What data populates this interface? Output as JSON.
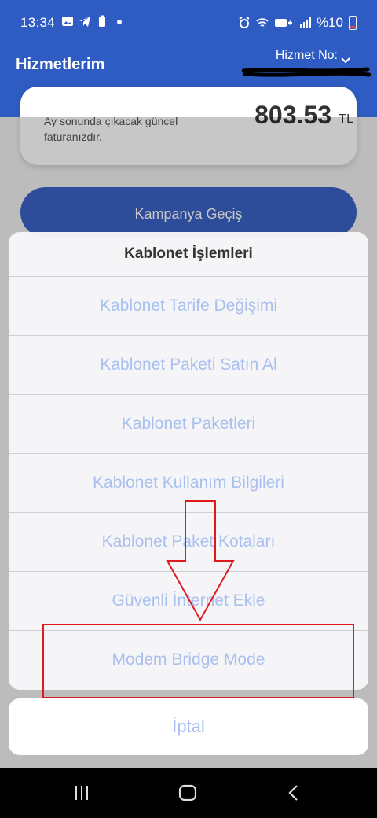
{
  "status_bar": {
    "time": "13:34",
    "battery_text": "%10"
  },
  "header": {
    "title": "Hizmetlerim",
    "service_label": "Hizmet No:"
  },
  "card": {
    "text": "Ay sonunda çıkacak güncel faturanızdır.",
    "amount": "803.53",
    "unit": "TL"
  },
  "campaign_button": {
    "label": "Kampanya Geçiş"
  },
  "sheet": {
    "title": "Kablonet İşlemleri",
    "options": [
      {
        "label": "Kablonet Tarife Değişimi"
      },
      {
        "label": "Kablonet Paketi Satın Al"
      },
      {
        "label": "Kablonet Paketleri"
      },
      {
        "label": "Kablonet Kullanım Bilgileri"
      },
      {
        "label": "Kablonet Paket Kotaları"
      },
      {
        "label": "Güvenli İnternet Ekle"
      },
      {
        "label": "Modem Bridge Mode"
      }
    ],
    "cancel_label": "İptal"
  },
  "colors": {
    "header": "#2f5cc3",
    "option_text": "#a9c0ef",
    "annotation": "#e0191f"
  }
}
